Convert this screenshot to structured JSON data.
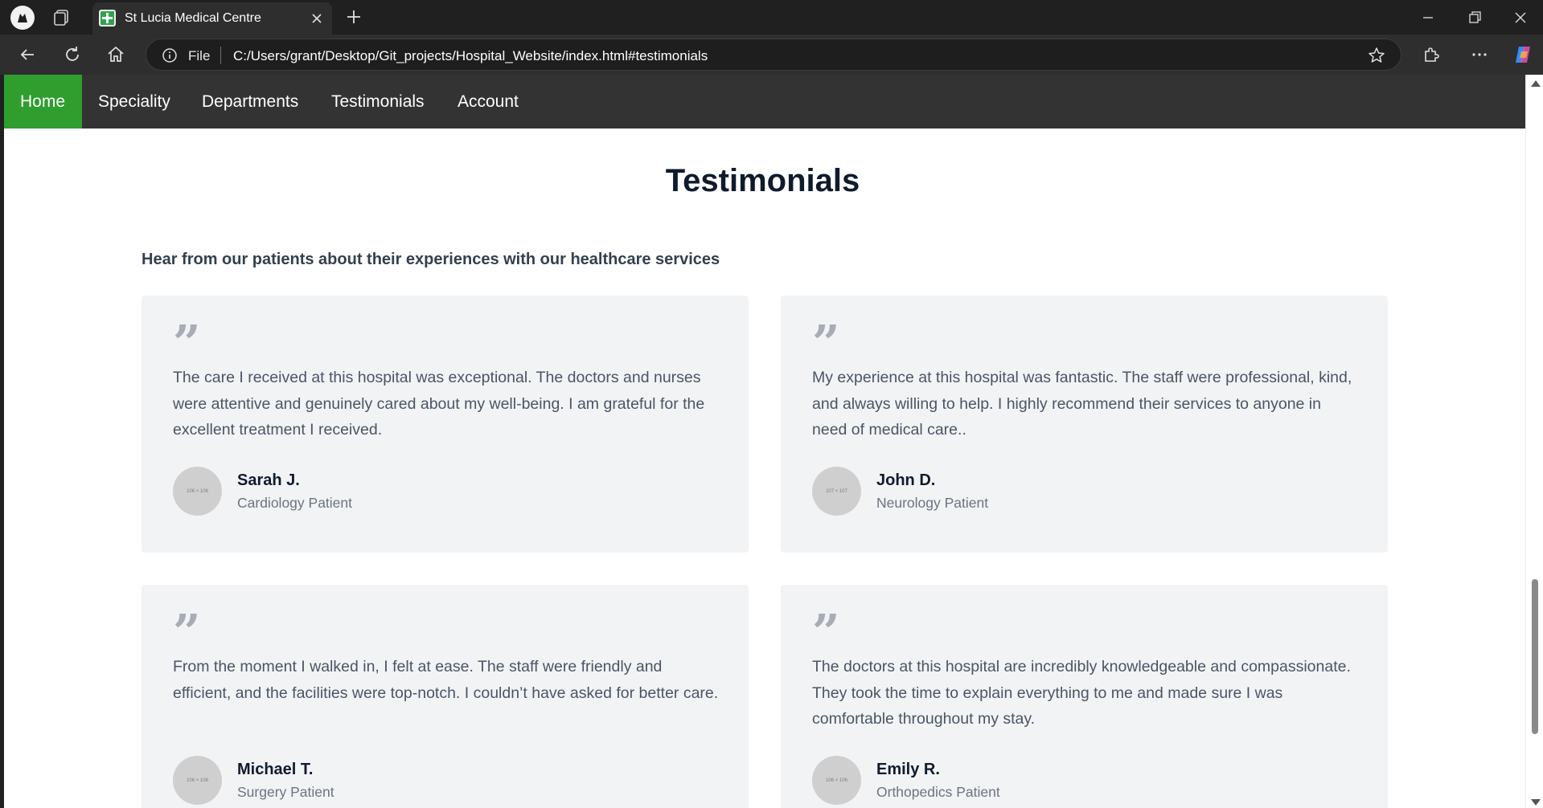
{
  "browser": {
    "tab_title": "St Lucia Medical Centre",
    "address_scheme_label": "File",
    "url": "C:/Users/grant/Desktop/Git_projects/Hospital_Website/index.html#testimonials"
  },
  "nav": {
    "items": [
      {
        "label": "Home",
        "active": true
      },
      {
        "label": "Speciality"
      },
      {
        "label": "Departments"
      },
      {
        "label": "Testimonials"
      },
      {
        "label": "Account"
      }
    ],
    "active_color": "#2f9e2f",
    "background_color": "#333333"
  },
  "testimonials": {
    "title": "Testimonials",
    "subtitle": "Hear from our patients about their experiences with our healthcare services",
    "quote_glyph": "”",
    "cards": [
      {
        "quote": "The care I received at this hospital was exceptional. The doctors and nurses were attentive and genuinely cared about my well-being. I am grateful for the excellent treatment I received.",
        "avatar_placeholder": "106 × 106",
        "name": "Sarah J.",
        "role": "Cardiology Patient"
      },
      {
        "quote": "My experience at this hospital was fantastic. The staff were professional, kind, and always willing to help. I highly recommend their services to anyone in need of medical care..",
        "avatar_placeholder": "107 × 107",
        "name": "John D.",
        "role": "Neurology Patient"
      },
      {
        "quote": "From the moment I walked in, I felt at ease. The staff were friendly and efficient, and the facilities were top-notch. I couldn’t have asked for better care.",
        "avatar_placeholder": "106 × 106",
        "name": "Michael T.",
        "role": "Surgery Patient"
      },
      {
        "quote": "The doctors at this hospital are incredibly knowledgeable and compassionate. They took the time to explain everything to me and made sure I was comfortable throughout my stay.",
        "avatar_placeholder": "106 × 106",
        "name": "Emily R.",
        "role": "Orthopedics Patient"
      }
    ]
  }
}
